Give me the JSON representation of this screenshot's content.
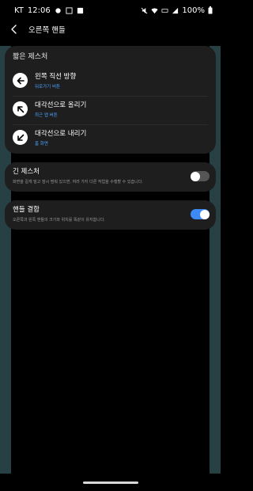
{
  "status_bar": {
    "carrier": "KT",
    "time": "12:06",
    "battery": "100%"
  },
  "header": {
    "title": "오른쪽 핸들"
  },
  "short_gestures": {
    "header": "짧은 제스처",
    "items": [
      {
        "label": "왼쪽 직선 방향",
        "sub": "뒤로가기 버튼",
        "icon": "arrow-left-icon"
      },
      {
        "label": "대각선으로 올리기",
        "sub": "최근 앱 버튼",
        "icon": "arrow-up-left-icon"
      },
      {
        "label": "대각선으로 내리기",
        "sub": "홈 화면",
        "icon": "arrow-down-left-icon"
      }
    ]
  },
  "long_gesture": {
    "label": "긴 제스처",
    "desc": "화면을 길게 밀고 잠시 멈춰 있으면, 여러 가지 다른 작업을 수행할 수 있습니다.",
    "enabled": false
  },
  "handle_sync": {
    "label": "핸들 결합",
    "desc": "오른쪽과 왼쪽 핸들의 크기와 위치를 똑같이 유지합니다.",
    "enabled": true
  },
  "colors": {
    "accent": "#3d8af7",
    "sub_text": "#4aa3ff",
    "card_bg": "#1e1e1e",
    "edge_handle": "#33565b"
  }
}
